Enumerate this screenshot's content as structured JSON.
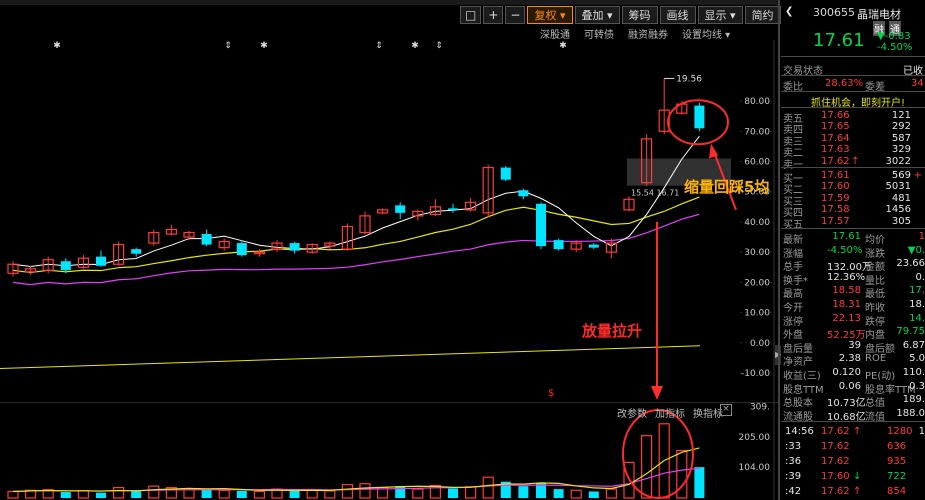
{
  "toolbar": {
    "items": [
      "□",
      "+",
      "−",
      "复权",
      "叠加",
      "筹码",
      "画线",
      "显示",
      "简约",
      "隐藏"
    ]
  },
  "subtoolbar": {
    "items": [
      "深股通",
      "可转债",
      "融资融券",
      "设置均线"
    ]
  },
  "price_axis": [
    "80.00",
    "70.00",
    "60.00",
    "50.00",
    "40.00",
    "30.00",
    "20.00",
    "10.00",
    "0.00",
    "-10.00"
  ],
  "vol_axis": [
    "309.",
    "205.00",
    "104.00"
  ],
  "vol_controls": [
    "改参数",
    "加指标",
    "换指标"
  ],
  "vol_close": "×",
  "collapse_handle": "▶",
  "chart_labels": {
    "high_price": "19.56",
    "mid_label": "15.54 16.71"
  },
  "annotations": {
    "shrink": "缩量回踩5均",
    "expand": "放量拉升",
    "marker": "$"
  },
  "colors": {
    "up": "#ff3b3b",
    "down": "#00e5ff",
    "ma5": "#ffffff",
    "ma10": "#e8e800",
    "ma20": "#e040fb",
    "annot": "#ff2a2a"
  },
  "chart_data": {
    "type": "candlestick",
    "candles": [
      [
        0,
        23.0,
        26.0,
        27.0,
        22.0,
        1
      ],
      [
        1,
        23.5,
        24.5,
        25.5,
        22.5,
        1
      ],
      [
        2,
        24.0,
        27.5,
        28.5,
        23.0,
        1
      ],
      [
        3,
        27.0,
        24.0,
        28.0,
        23.0,
        0
      ],
      [
        4,
        25.0,
        28.0,
        29.0,
        24.5,
        1
      ],
      [
        5,
        28.5,
        25.5,
        30.5,
        25.0,
        0
      ],
      [
        6,
        26.0,
        32.5,
        33.5,
        25.5,
        1
      ],
      [
        7,
        31.0,
        29.5,
        31.5,
        28.5,
        0
      ],
      [
        8,
        33.0,
        36.5,
        37.5,
        32.0,
        1
      ],
      [
        9,
        36.0,
        37.5,
        39.0,
        35.5,
        1
      ],
      [
        10,
        35.0,
        36.5,
        37.0,
        34.0,
        1
      ],
      [
        11,
        36.0,
        32.5,
        37.5,
        32.0,
        0
      ],
      [
        12,
        31.5,
        33.5,
        34.5,
        30.5,
        1
      ],
      [
        13,
        33.0,
        29.0,
        34.0,
        28.5,
        0
      ],
      [
        14,
        29.5,
        30.0,
        31.0,
        28.5,
        1
      ],
      [
        15,
        31.0,
        33.0,
        34.0,
        30.0,
        1
      ],
      [
        16,
        33.0,
        30.5,
        33.5,
        29.5,
        0
      ],
      [
        17,
        30.0,
        32.5,
        33.0,
        29.5,
        1
      ],
      [
        18,
        32.0,
        33.0,
        33.5,
        31.0,
        1
      ],
      [
        19,
        31.0,
        38.5,
        39.5,
        30.5,
        1
      ],
      [
        20,
        36.5,
        42.0,
        43.5,
        36.0,
        1
      ],
      [
        21,
        43.0,
        44.0,
        44.5,
        42.5,
        1
      ],
      [
        22,
        45.5,
        43.0,
        46.5,
        41.0,
        0
      ],
      [
        23,
        42.0,
        43.5,
        44.0,
        40.5,
        1
      ],
      [
        24,
        42.5,
        45.0,
        47.5,
        42.0,
        1
      ],
      [
        25,
        44.5,
        44.0,
        46.0,
        43.0,
        0
      ],
      [
        26,
        44.0,
        46.5,
        48.0,
        43.5,
        1
      ],
      [
        27,
        43.0,
        58.0,
        59.0,
        41.5,
        1
      ],
      [
        28,
        58.0,
        54.0,
        58.5,
        53.5,
        0
      ],
      [
        29,
        50.5,
        48.5,
        51.0,
        47.5,
        0
      ],
      [
        30,
        46.0,
        32.0,
        46.5,
        31.0,
        0
      ],
      [
        31,
        34.0,
        31.0,
        34.5,
        30.5,
        0
      ],
      [
        32,
        31.0,
        33.0,
        34.0,
        30.0,
        1
      ],
      [
        33,
        32.5,
        31.5,
        33.0,
        31.0,
        0
      ],
      [
        34,
        30.0,
        33.0,
        34.5,
        28.0,
        1
      ],
      [
        35,
        44.0,
        47.5,
        48.5,
        43.5,
        1
      ],
      [
        36,
        53.0,
        67.5,
        69.0,
        52.0,
        1
      ],
      [
        37,
        70.0,
        77.0,
        87.5,
        69.0,
        1
      ],
      [
        38,
        76.0,
        79.0,
        80.0,
        75.5,
        1
      ],
      [
        39,
        78.5,
        71.0,
        79.5,
        70.0,
        0
      ]
    ],
    "volume": [
      [
        0,
        22,
        1
      ],
      [
        1,
        26,
        1
      ],
      [
        2,
        28,
        1
      ],
      [
        3,
        20,
        0
      ],
      [
        4,
        25,
        1
      ],
      [
        5,
        18,
        0
      ],
      [
        6,
        35,
        1
      ],
      [
        7,
        22,
        0
      ],
      [
        8,
        40,
        1
      ],
      [
        9,
        35,
        1
      ],
      [
        10,
        30,
        1
      ],
      [
        11,
        28,
        0
      ],
      [
        12,
        26,
        1
      ],
      [
        13,
        24,
        0
      ],
      [
        14,
        22,
        1
      ],
      [
        15,
        30,
        1
      ],
      [
        16,
        25,
        0
      ],
      [
        17,
        27,
        1
      ],
      [
        18,
        24,
        1
      ],
      [
        19,
        45,
        1
      ],
      [
        20,
        48,
        1
      ],
      [
        21,
        35,
        1
      ],
      [
        22,
        40,
        0
      ],
      [
        23,
        30,
        1
      ],
      [
        24,
        42,
        1
      ],
      [
        25,
        32,
        0
      ],
      [
        26,
        38,
        1
      ],
      [
        27,
        70,
        1
      ],
      [
        28,
        55,
        0
      ],
      [
        29,
        40,
        0
      ],
      [
        30,
        52,
        0
      ],
      [
        31,
        30,
        0
      ],
      [
        32,
        26,
        1
      ],
      [
        33,
        22,
        0
      ],
      [
        34,
        30,
        1
      ],
      [
        35,
        120,
        1
      ],
      [
        36,
        210,
        1
      ],
      [
        37,
        250,
        1
      ],
      [
        38,
        160,
        1
      ],
      [
        39,
        104,
        0
      ]
    ]
  },
  "panel": {
    "code": "300655",
    "name": "晶瑞电材",
    "badges": [
      "融",
      "通"
    ],
    "price": "17.61",
    "change": "-0.83",
    "change_pct": "-4.50%",
    "status_label": "交易状态",
    "status_value": "已收",
    "ratio": {
      "wb_label": "委比",
      "wb_value": "28.63%",
      "wc_label": "委差",
      "wc_value": "34"
    },
    "promo": "抓住机会，即刻开户!",
    "asks": [
      {
        "label": "卖五",
        "price": "17.66",
        "vol": "121"
      },
      {
        "label": "卖四",
        "price": "17.65",
        "vol": "292"
      },
      {
        "label": "卖三",
        "price": "17.64",
        "vol": "587"
      },
      {
        "label": "卖二",
        "price": "17.63",
        "vol": "329"
      },
      {
        "label": "卖一",
        "price": "17.62",
        "vol": "3022",
        "mark": "↑"
      }
    ],
    "bids": [
      {
        "label": "买一",
        "price": "17.61",
        "vol": "569",
        "mark": "+"
      },
      {
        "label": "买二",
        "price": "17.60",
        "vol": "5031"
      },
      {
        "label": "买三",
        "price": "17.59",
        "vol": "481"
      },
      {
        "label": "买四",
        "price": "17.58",
        "vol": "1456"
      },
      {
        "label": "买五",
        "price": "17.57",
        "vol": "305"
      }
    ],
    "stats": [
      {
        "l1": "最新",
        "v1": "17.61",
        "c1": "green",
        "l2": "均价",
        "v2": "1",
        "c2": "red"
      },
      {
        "l1": "涨幅",
        "v1": "-4.50%",
        "c1": "green",
        "l2": "涨跌",
        "v2": "▼0.",
        "c2": "green"
      },
      {
        "l1": "总手",
        "v1": "132.00万",
        "c1": "white",
        "l2": "金额",
        "v2": "23.66",
        "c2": "white"
      },
      {
        "l1": "换手*",
        "v1": "12.36%",
        "c1": "white",
        "l2": "量比",
        "v2": "0.",
        "c2": "white"
      },
      {
        "l1": "最高",
        "v1": "18.58",
        "c1": "red",
        "l2": "最低",
        "v2": "17.",
        "c2": "green"
      },
      {
        "l1": "今开",
        "v1": "18.31",
        "c1": "red",
        "l2": "昨收",
        "v2": "18.",
        "c2": "white"
      },
      {
        "l1": "涨停",
        "v1": "22.13",
        "c1": "red",
        "l2": "跌停",
        "v2": "14.",
        "c2": "green"
      },
      {
        "l1": "外盘",
        "v1": "52.25万",
        "c1": "red",
        "l2": "内盘",
        "v2": "79.75",
        "c2": "green"
      },
      {
        "l1": "盘后量",
        "v1": "39",
        "c1": "white",
        "l2": "盘后额",
        "v2": "6.87",
        "c2": "white"
      },
      {
        "l1": "净资产",
        "v1": "2.38",
        "c1": "white",
        "l2": "ROE",
        "v2": "5.0",
        "c2": "white"
      },
      {
        "l1": "收益(三)",
        "v1": "0.120",
        "c1": "white",
        "l2": "PE(动)",
        "v2": "110.",
        "c2": "white"
      },
      {
        "l1": "股息TTM",
        "v1": "0.06",
        "c1": "white",
        "l2": "股息率TTM",
        "v2": "0.3",
        "c2": "white"
      },
      {
        "l1": "总股本",
        "v1": "10.73亿",
        "c1": "white",
        "l2": "总值",
        "v2": "189.",
        "c2": "white"
      },
      {
        "l1": "流通股",
        "v1": "10.68亿",
        "c1": "white",
        "l2": "流值",
        "v2": "188.0",
        "c2": "white"
      }
    ],
    "ticks": [
      {
        "time": "14:56",
        "price": "17.62",
        "mark": "↑",
        "vol": "1280",
        "suffix": "1"
      },
      {
        "time": ":33",
        "price": "17.62",
        "mark": "",
        "vol": "636",
        "suffix": ""
      },
      {
        "time": ":36",
        "price": "17.62",
        "mark": "",
        "vol": "935",
        "suffix": ""
      },
      {
        "time": ":39",
        "price": "17.60",
        "mark": "↓",
        "vol": "722",
        "suffix": ""
      },
      {
        "time": ":42",
        "price": "17.62",
        "mark": "↑",
        "vol": "854",
        "suffix": ""
      }
    ]
  }
}
